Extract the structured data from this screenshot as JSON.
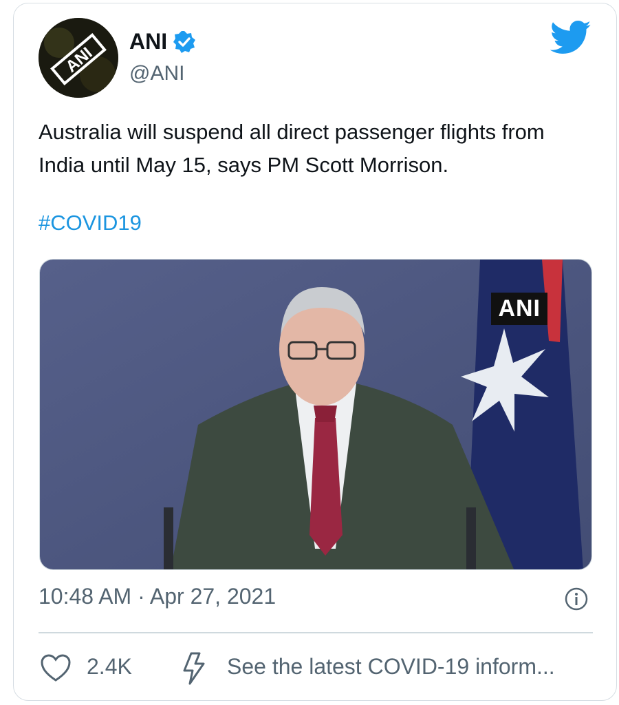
{
  "tweet": {
    "author_name": "ANI",
    "author_handle": "@ANI",
    "avatar_text": "ANI",
    "verified": true,
    "text": "Australia will suspend all direct passenger flights from India until May 15, says PM Scott Morrison.",
    "hashtag": "#COVID19",
    "media_watermark": "ANI",
    "timestamp": "10:48 AM · Apr 27, 2021",
    "likes": "2.4K",
    "covid_link": "See the latest COVID-19 inform..."
  },
  "icons": {
    "twitter_bird": "twitter-bird-icon",
    "verified": "verified-badge-icon",
    "info": "info-icon",
    "like": "heart-icon",
    "covid": "lightning-bolt-icon"
  },
  "colors": {
    "accent": "#1d9bf0",
    "hashtag": "#1b95e0",
    "text": "#0f1419",
    "secondary_text": "#536471",
    "border": "#cfd9de"
  }
}
